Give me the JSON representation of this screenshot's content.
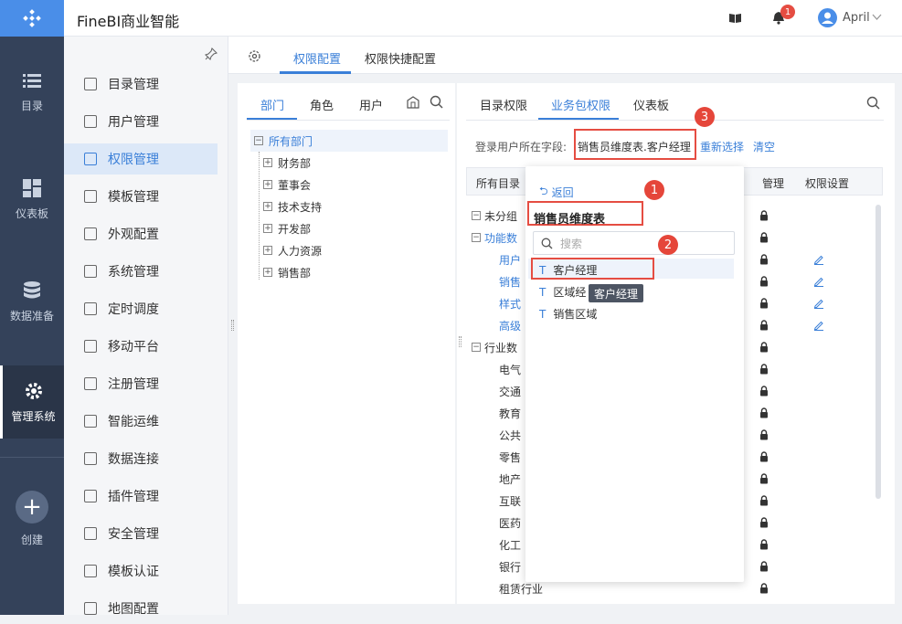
{
  "app": {
    "title": "FineBI商业智能",
    "notification_count": "1",
    "user": "April"
  },
  "left_nav": [
    {
      "label": "目录",
      "icon": "list-icon"
    },
    {
      "label": "仪表板",
      "icon": "dashboard-icon"
    },
    {
      "label": "数据准备",
      "icon": "database-icon"
    },
    {
      "label": "管理系统",
      "icon": "gear-icon"
    },
    {
      "label": "创建",
      "icon": "plus-icon"
    }
  ],
  "menu": [
    "目录管理",
    "用户管理",
    "权限管理",
    "模板管理",
    "外观配置",
    "系统管理",
    "定时调度",
    "移动平台",
    "注册管理",
    "智能运维",
    "数据连接",
    "插件管理",
    "安全管理",
    "模板认证",
    "地图配置"
  ],
  "top_tabs": [
    "权限配置",
    "权限快捷配置"
  ],
  "left_panel": {
    "tabs": [
      "部门",
      "角色",
      "用户"
    ],
    "root": "所有部门",
    "departments": [
      "财务部",
      "董事会",
      "技术支持",
      "开发部",
      "人力资源",
      "销售部"
    ]
  },
  "right_panel": {
    "tabs": [
      "目录权限",
      "业务包权限",
      "仪表板"
    ],
    "field_label": "登录用户所在字段:",
    "field_value": "销售员维度表.客户经理",
    "reselect": "重新选择",
    "clear": "清空",
    "columns": [
      "所有目录",
      "管理",
      "权限设置"
    ],
    "rows": [
      {
        "label": "未分组",
        "tree": "−",
        "blue": false
      },
      {
        "label": "功能数",
        "tree": "−",
        "blue": true
      },
      {
        "label": "用户",
        "tree": "",
        "blue": true
      },
      {
        "label": "销售",
        "tree": "",
        "blue": true
      },
      {
        "label": "样式",
        "tree": "",
        "blue": true
      },
      {
        "label": "高级",
        "tree": "",
        "blue": true
      },
      {
        "label": "行业数",
        "tree": "−",
        "blue": false
      },
      {
        "label": "电气",
        "tree": "",
        "blue": false
      },
      {
        "label": "交通",
        "tree": "",
        "blue": false
      },
      {
        "label": "教育",
        "tree": "",
        "blue": false
      },
      {
        "label": "公共",
        "tree": "",
        "blue": false
      },
      {
        "label": "零售",
        "tree": "",
        "blue": false
      },
      {
        "label": "地产",
        "tree": "",
        "blue": false
      },
      {
        "label": "互联",
        "tree": "",
        "blue": false
      },
      {
        "label": "医药",
        "tree": "",
        "blue": false
      },
      {
        "label": "化工",
        "tree": "",
        "blue": false
      },
      {
        "label": "银行",
        "tree": "",
        "blue": false
      },
      {
        "label": "租赁行业",
        "tree": "",
        "blue": false
      }
    ]
  },
  "popup": {
    "back": "返回",
    "table": "销售员维度表",
    "search_placeholder": "搜索",
    "fields": [
      "客户经理",
      "区域经",
      "销售区域"
    ],
    "tooltip": "客户经理"
  },
  "callouts": [
    "1",
    "2",
    "3"
  ]
}
